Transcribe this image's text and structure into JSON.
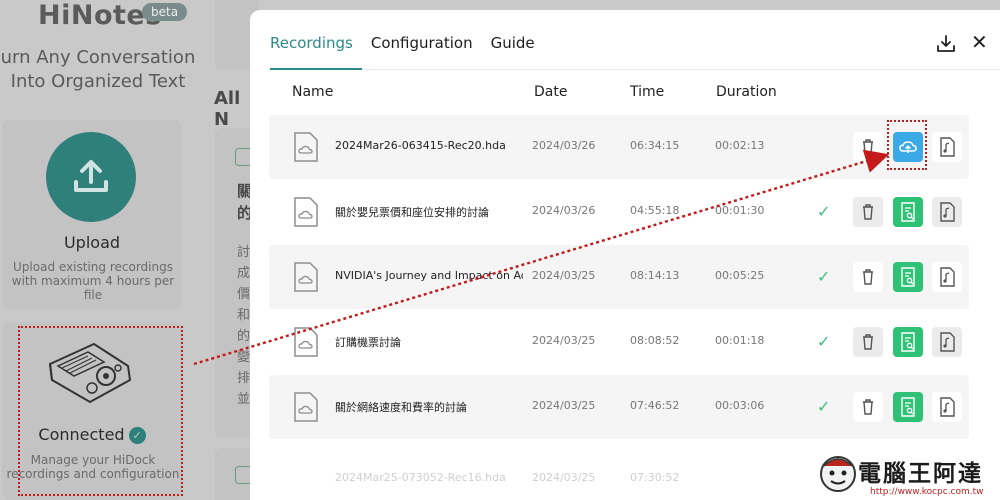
{
  "background": {
    "brand": "HiNotes",
    "beta": "beta",
    "tagline": "urn Any Conversation Into Organized Text",
    "upload_title": "Upload",
    "upload_desc": "Upload existing recordings with maximum 4 hours per file",
    "connected_title": "Connected",
    "connected_desc": "Manage your HiDock recordings and configuration",
    "notes_heading": "All N",
    "note_chars": "關的",
    "note_body_chars": "討成價和的變排並"
  },
  "modal": {
    "tabs": [
      {
        "label": "Recordings",
        "active": true
      },
      {
        "label": "Configuration",
        "active": false
      },
      {
        "label": "Guide",
        "active": false
      }
    ],
    "columns": {
      "name": "Name",
      "date": "Date",
      "time": "Time",
      "duration": "Duration"
    },
    "recordings": [
      {
        "name": "2024Mar26-063415-Rec20.hda",
        "date": "2024/03/26",
        "time": "06:34:15",
        "duration": "00:02:13",
        "synced": false,
        "action": "upload"
      },
      {
        "name": "關於嬰兒票價和座位安排的討論",
        "date": "2024/03/26",
        "time": "04:55:18",
        "duration": "00:01:30",
        "synced": true,
        "action": "transcript"
      },
      {
        "name": "NVIDIA's Journey and Impact on Accelerated Computing",
        "date": "2024/03/25",
        "time": "08:14:13",
        "duration": "00:05:25",
        "synced": true,
        "action": "transcript"
      },
      {
        "name": "訂購機票討論",
        "date": "2024/03/25",
        "time": "08:08:52",
        "duration": "00:01:18",
        "synced": true,
        "action": "transcript"
      },
      {
        "name": "關於網絡速度和費率的討論",
        "date": "2024/03/25",
        "time": "07:46:52",
        "duration": "00:03:06",
        "synced": true,
        "action": "transcript"
      }
    ],
    "ghost_row": {
      "name": "2024Mar25-073052-Rec16.hda",
      "date": "2024/03/25",
      "time": "07:30:52"
    }
  },
  "watermark": {
    "title": "電腦王阿達",
    "url": "http://www.kocpc.com.tw"
  },
  "colors": {
    "accent": "#2b8a8a",
    "upload": "#3aa9e5",
    "transcript": "#2fc277",
    "check": "#3fc07e",
    "highlight": "#c31a1a"
  }
}
